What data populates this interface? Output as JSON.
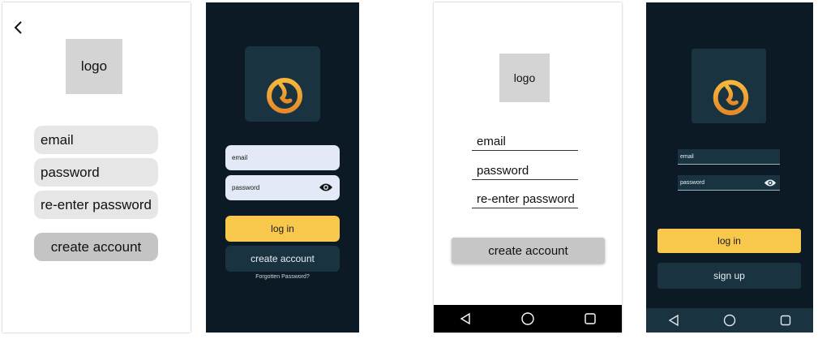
{
  "colors": {
    "dark_background": "#0b1a24",
    "dark_panel": "#1a3340",
    "accent_yellow": "#f7c84b",
    "icon_gradient_top": "#f6b73c",
    "icon_gradient_bottom": "#e58a2a",
    "wireframe_grey": "#d4d4d4"
  },
  "screen1": {
    "back_icon": "chevron-left-icon",
    "logo_text": "logo",
    "fields": {
      "email": "email",
      "password": "password",
      "reenter_password": "re-enter password"
    },
    "create_account_label": "create account"
  },
  "screen2": {
    "app_icon": "app-logo-b-icon",
    "email_placeholder": "email",
    "password_placeholder": "password",
    "eye_icon": "eye-icon",
    "login_label": "log in",
    "create_account_label": "create account",
    "forgot_password_label": "Forgotten Password?"
  },
  "screen3": {
    "logo_text": "logo",
    "fields": {
      "email": "email",
      "password": "password",
      "reenter_password": "re-enter password"
    },
    "create_account_label": "create account",
    "nav_icons": [
      "back-triangle-icon",
      "home-circle-icon",
      "recents-square-icon"
    ]
  },
  "screen4": {
    "app_icon": "app-logo-b-icon",
    "email_placeholder": "email",
    "password_placeholder": "password",
    "eye_icon": "eye-icon",
    "login_label": "log in",
    "signup_label": "sign up",
    "nav_icons": [
      "back-triangle-icon",
      "home-circle-icon",
      "recents-square-icon"
    ]
  }
}
